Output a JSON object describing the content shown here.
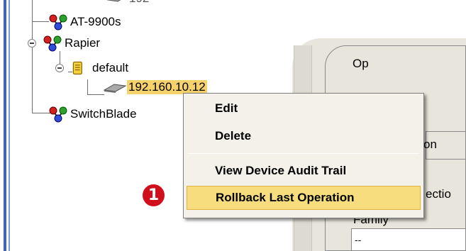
{
  "tree": {
    "items": [
      {
        "label": "AT-9900s",
        "icon": "network-node-icon"
      },
      {
        "label": "Rapier",
        "icon": "network-node-icon"
      },
      {
        "label": "default",
        "icon": "scroll-folder-icon"
      },
      {
        "label": "192.160.10.12",
        "icon": "device-icon"
      },
      {
        "label": "SwitchBlade",
        "icon": "network-node-icon"
      }
    ],
    "truncated_top_label": "192"
  },
  "background_panel": {
    "top_text": "Op",
    "tab_text": "on",
    "right_text": "ectio",
    "family_text": "Family",
    "dash_text": "--"
  },
  "context_menu": {
    "items": [
      {
        "label": "Edit"
      },
      {
        "label": "Delete"
      },
      {
        "label": "View Device Audit Trail"
      },
      {
        "label": "Rollback Last Operation"
      }
    ],
    "hovered_index": 3
  },
  "callout": {
    "number": "1"
  },
  "colors": {
    "selection": "#f5d26b",
    "menu_hover": "#f7dd7d",
    "callout_red": "#d10f1c",
    "splitter_blue": "#3d63c8"
  }
}
